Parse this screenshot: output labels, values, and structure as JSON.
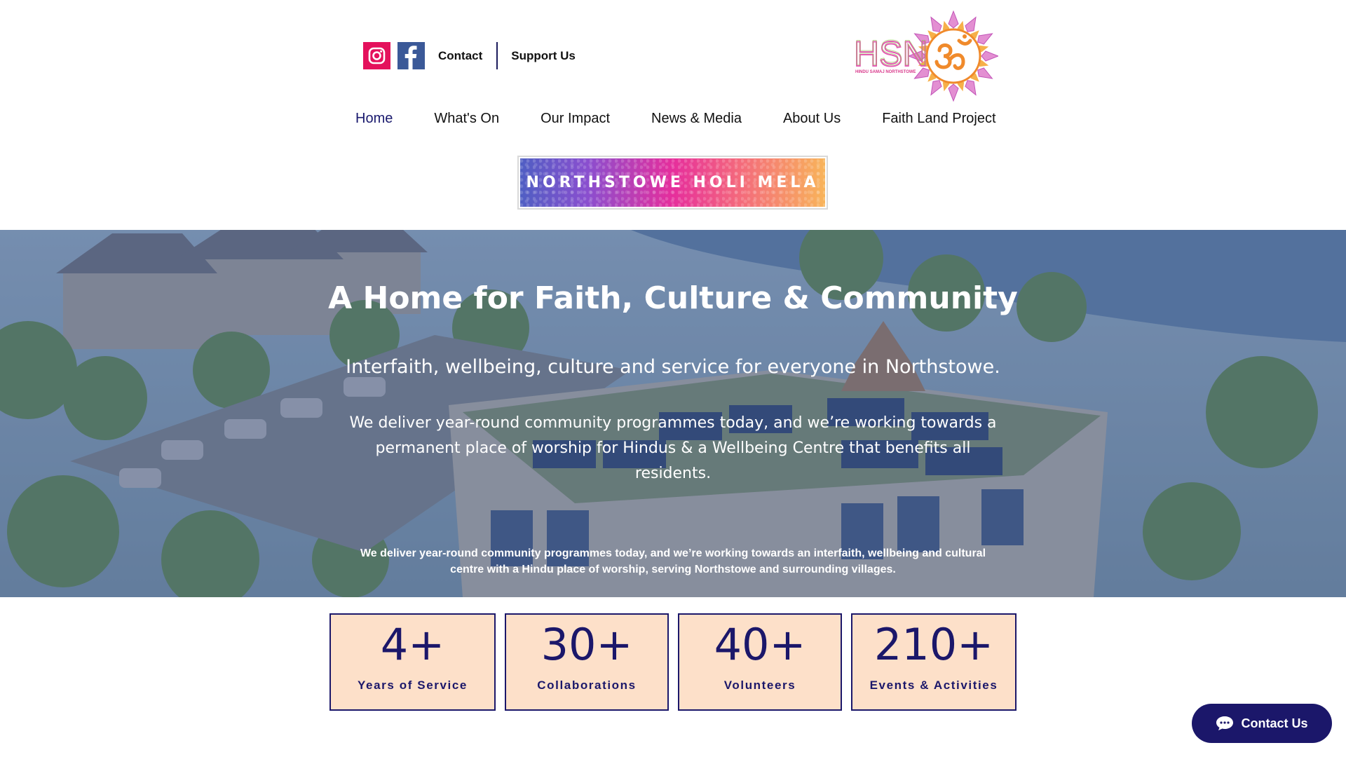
{
  "header": {
    "social": {
      "instagram_icon": "instagram-icon",
      "facebook_icon": "facebook-icon"
    },
    "top_links": [
      "Contact",
      "Support Us"
    ],
    "logo": {
      "text": "HSN",
      "subtext": "HINDU SAMAJ NORTHSTOWE",
      "symbol": "om-symbol-icon"
    }
  },
  "nav": {
    "items": [
      {
        "label": "Home",
        "active": true
      },
      {
        "label": "What's On",
        "active": false
      },
      {
        "label": "Our Impact",
        "active": false
      },
      {
        "label": "News & Media",
        "active": false
      },
      {
        "label": "About Us",
        "active": false
      },
      {
        "label": "Faith Land Project",
        "active": false
      }
    ]
  },
  "banner": {
    "label": "NORTHSTOWE HOLI MELA"
  },
  "hero": {
    "title": "A Home for Faith, Culture & Community",
    "subtitle": "Interfaith, wellbeing, culture and service for everyone in Northstowe.",
    "paragraph": "We deliver year-round community programmes today, and we’re working towards a permanent place of worship for Hindus & a Wellbeing Centre that benefits all residents.",
    "small_before": "We deliver year-round community programmes today, and we’re working towards an ",
    "small_bold": "interfaith, wellbeing and cultural centre",
    "small_after": " with a Hindu place of worship, serving Northstowe and surrounding villages."
  },
  "stats": [
    {
      "value": "4+",
      "label": "Years of Service"
    },
    {
      "value": "30+",
      "label": "Collaborations"
    },
    {
      "value": "40+",
      "label": "Volunteers"
    },
    {
      "value": "210+",
      "label": "Events & Activities"
    }
  ],
  "chat": {
    "label": "Contact Us",
    "icon": "chat-bubble-icon"
  },
  "colors": {
    "navy": "#1b176a",
    "stat_bg": "#fde0c9",
    "hero_overlay": "#2e4278"
  }
}
